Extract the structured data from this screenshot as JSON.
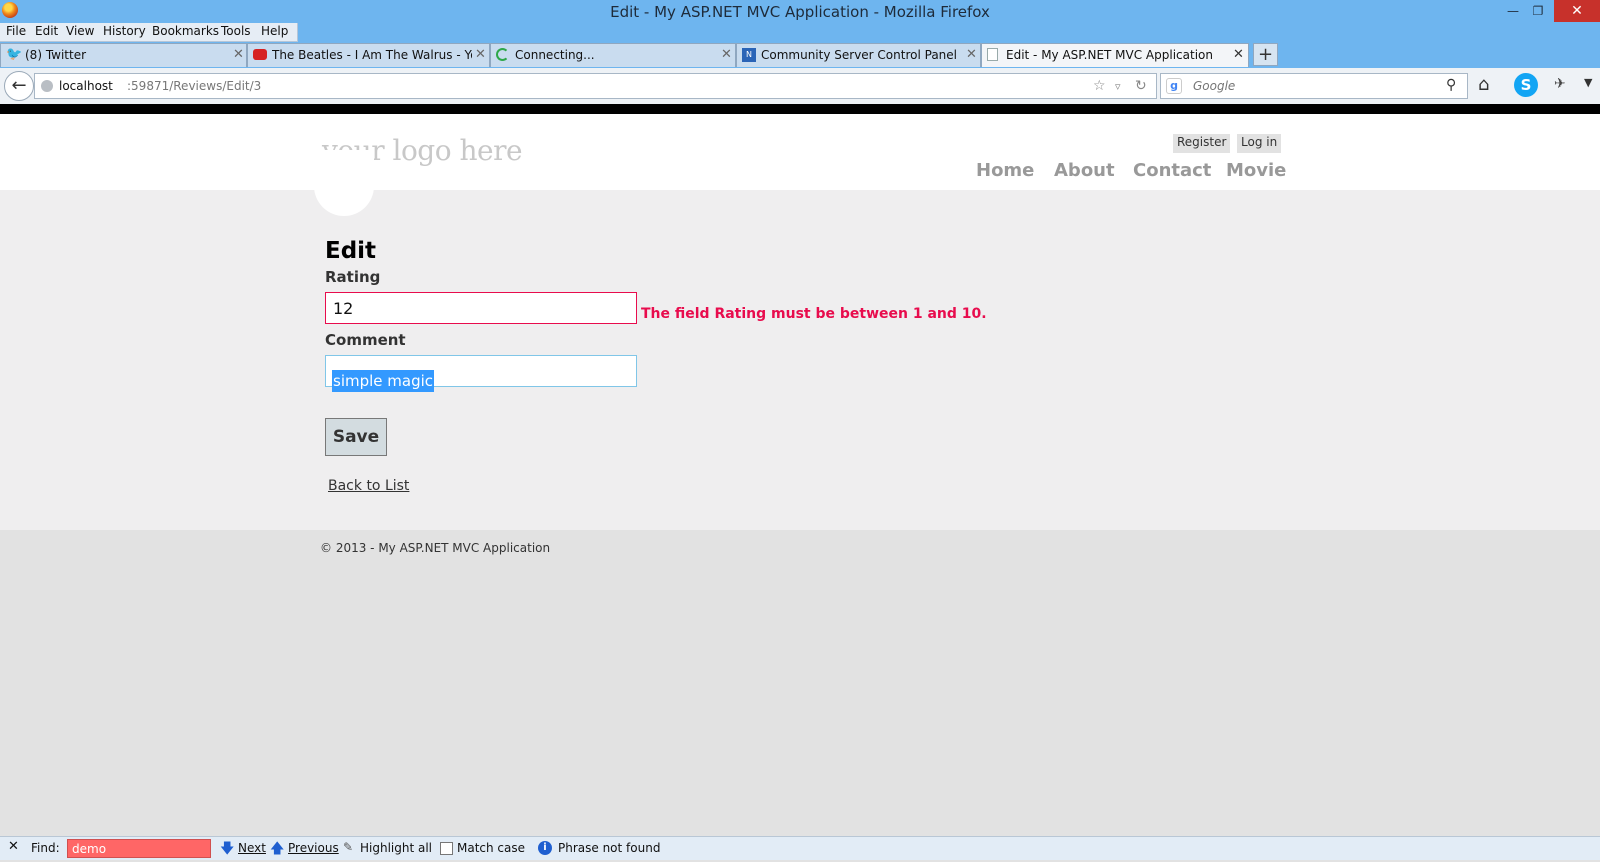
{
  "window": {
    "title": "Edit - My ASP.NET MVC Application - Mozilla Firefox",
    "min_glyph": "—",
    "max_glyph": "❐",
    "close_glyph": "✕"
  },
  "menu": {
    "file": "File",
    "edit": "Edit",
    "view": "View",
    "history": "History",
    "bookmarks": "Bookmarks",
    "tools": "Tools",
    "help": "Help"
  },
  "tabs": [
    {
      "label": "(8) Twitter",
      "icon": "twitter-icon",
      "active": false
    },
    {
      "label": "The Beatles - I Am The Walrus - YouT...",
      "icon": "youtube-icon",
      "active": false
    },
    {
      "label": "Connecting...",
      "icon": "loading-icon",
      "active": false
    },
    {
      "label": "Community Server Control Panel",
      "icon": "aspnet-icon",
      "active": false
    },
    {
      "label": "Edit - My ASP.NET MVC Application",
      "icon": "page-icon",
      "active": true
    }
  ],
  "tab_close_glyph": "✕",
  "new_tab_glyph": "+",
  "navbar": {
    "back_glyph": "←",
    "url_host": "localhost",
    "url_path": ":59871/Reviews/Edit/3",
    "bookmark_star_glyph": "☆",
    "dropdown_glyph": "▿",
    "reload_glyph": "↻",
    "search_engine_glyph": "g",
    "search_placeholder": "Google",
    "search_go_glyph": "⚲",
    "home_glyph": "⌂",
    "skype_glyph": "S",
    "ext_glyph": "✈",
    "menu_arrow_glyph": "▼"
  },
  "site": {
    "logo": "your logo here",
    "register": "Register",
    "login": "Log in",
    "nav": {
      "home": "Home",
      "about": "About",
      "contact": "Contact",
      "movie": "Movie"
    }
  },
  "form": {
    "title": "Edit",
    "rating_label": "Rating",
    "rating_value": "12",
    "rating_error": "The field Rating must be between 1 and 10.",
    "comment_label": "Comment",
    "comment_value": "simple magic",
    "save_label": "Save",
    "back_link": "Back to List"
  },
  "footer": {
    "copyright": "© 2013 - My ASP.NET MVC Application"
  },
  "findbar": {
    "close_glyph": "✕",
    "label": "Find:",
    "value": "demo",
    "next_glyph": "🡇",
    "next": "Next",
    "prev_glyph": "🡅",
    "previous": "Previous",
    "highlight_glyph": "✎",
    "highlight_all": "Highlight all",
    "match_case": "Match case",
    "info_glyph": "i",
    "status": "Phrase not found"
  },
  "colors": {
    "chrome_bg": "#6eb5ef",
    "error_red": "#e80c4d",
    "find_not_found": "#ff6666",
    "selection": "#3399ff"
  }
}
